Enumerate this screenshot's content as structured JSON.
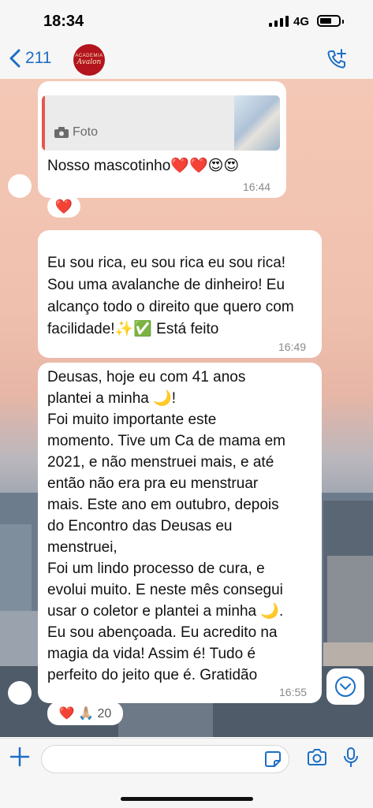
{
  "status": {
    "time": "18:34",
    "network": "4G"
  },
  "header": {
    "back_count": "211",
    "avatar_top": "ACADEMIA",
    "avatar_bottom": "Avalon"
  },
  "messages": [
    {
      "quote_label": "Foto",
      "text": "Nosso mascotinho❤️❤️😍😍",
      "time": "16:44",
      "reaction": "❤️"
    },
    {
      "text": "Eu sou rica, eu sou rica eu sou rica! Sou uma avalanche de dinheiro! Eu alcanço todo o direito que quero com facilidade!✨✅ Está feito",
      "time": "16:49"
    },
    {
      "lines": [
        "Deusas, hoje eu com 41 anos",
        "plantei a minha 🌙!",
        "Foi muito importante este",
        "momento. Tive um Ca de mama em",
        "2021, e não menstruei mais, e até",
        "então não era pra eu menstruar",
        "mais.  Este ano em outubro, depois",
        "do Encontro das Deusas eu",
        "menstruei,",
        "Foi um lindo processo de cura, e",
        "evolui muito. E neste mês consegui",
        "usar o coletor e plantei a minha 🌙.",
        "Eu sou abençoada. Eu acredito na",
        "magia da vida! Assim é! Tudo é",
        "perfeito do jeito que é. Gratidão"
      ],
      "time": "16:55",
      "reaction": "❤️ 🙏🏼 20"
    }
  ],
  "icons": [
    "back-chevron-icon",
    "add-call-icon",
    "camera-icon",
    "plus-icon",
    "sticker-icon",
    "microphone-icon",
    "chevron-down-icon"
  ],
  "colors": {
    "accent": "#1c6fc5",
    "reply_bar": "#e6574d",
    "avatar": "#b3141d"
  }
}
